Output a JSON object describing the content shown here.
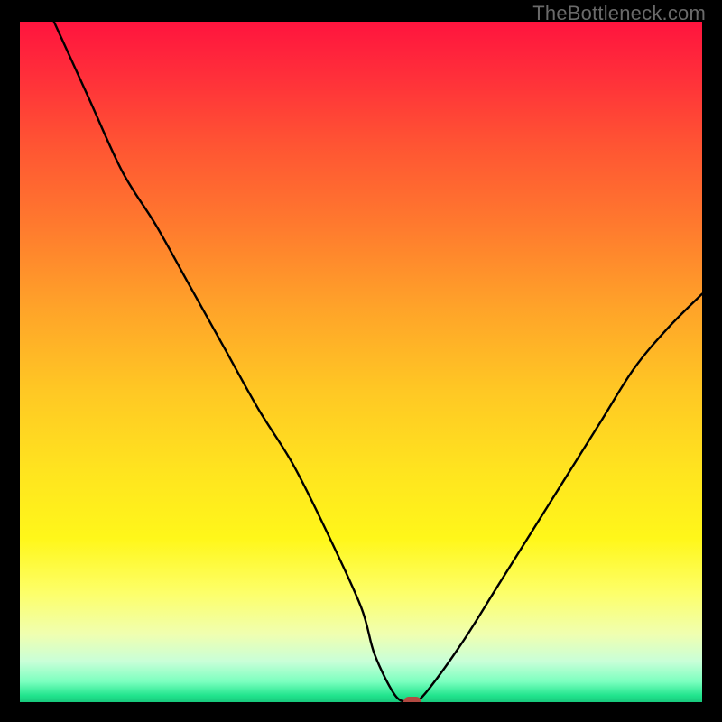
{
  "watermark": "TheBottleneck.com",
  "colors": {
    "background": "#000000",
    "watermark": "#6a6a6a",
    "curve": "#000000",
    "marker": "#b24a42"
  },
  "chart_data": {
    "type": "line",
    "title": "",
    "xlabel": "",
    "ylabel": "",
    "xlim": [
      0,
      100
    ],
    "ylim": [
      0,
      100
    ],
    "grid": false,
    "legend": false,
    "series": [
      {
        "name": "bottleneck-curve",
        "x": [
          5,
          10,
          15,
          20,
          25,
          30,
          35,
          40,
          45,
          50,
          52,
          55,
          57,
          58,
          60,
          65,
          70,
          75,
          80,
          85,
          90,
          95,
          100
        ],
        "y": [
          100,
          89,
          78,
          70,
          61,
          52,
          43,
          35,
          25,
          14,
          7,
          1,
          0,
          0,
          2,
          9,
          17,
          25,
          33,
          41,
          49,
          55,
          60
        ]
      }
    ],
    "annotations": [
      {
        "name": "optimum-marker",
        "x": 57.5,
        "y": 0
      }
    ],
    "background_gradient": {
      "direction": "top-to-bottom",
      "stops": [
        {
          "pos": 0,
          "color": "#ff143e"
        },
        {
          "pos": 50,
          "color": "#ffc724"
        },
        {
          "pos": 85,
          "color": "#fdff6a"
        },
        {
          "pos": 100,
          "color": "#18c97c"
        }
      ]
    }
  }
}
